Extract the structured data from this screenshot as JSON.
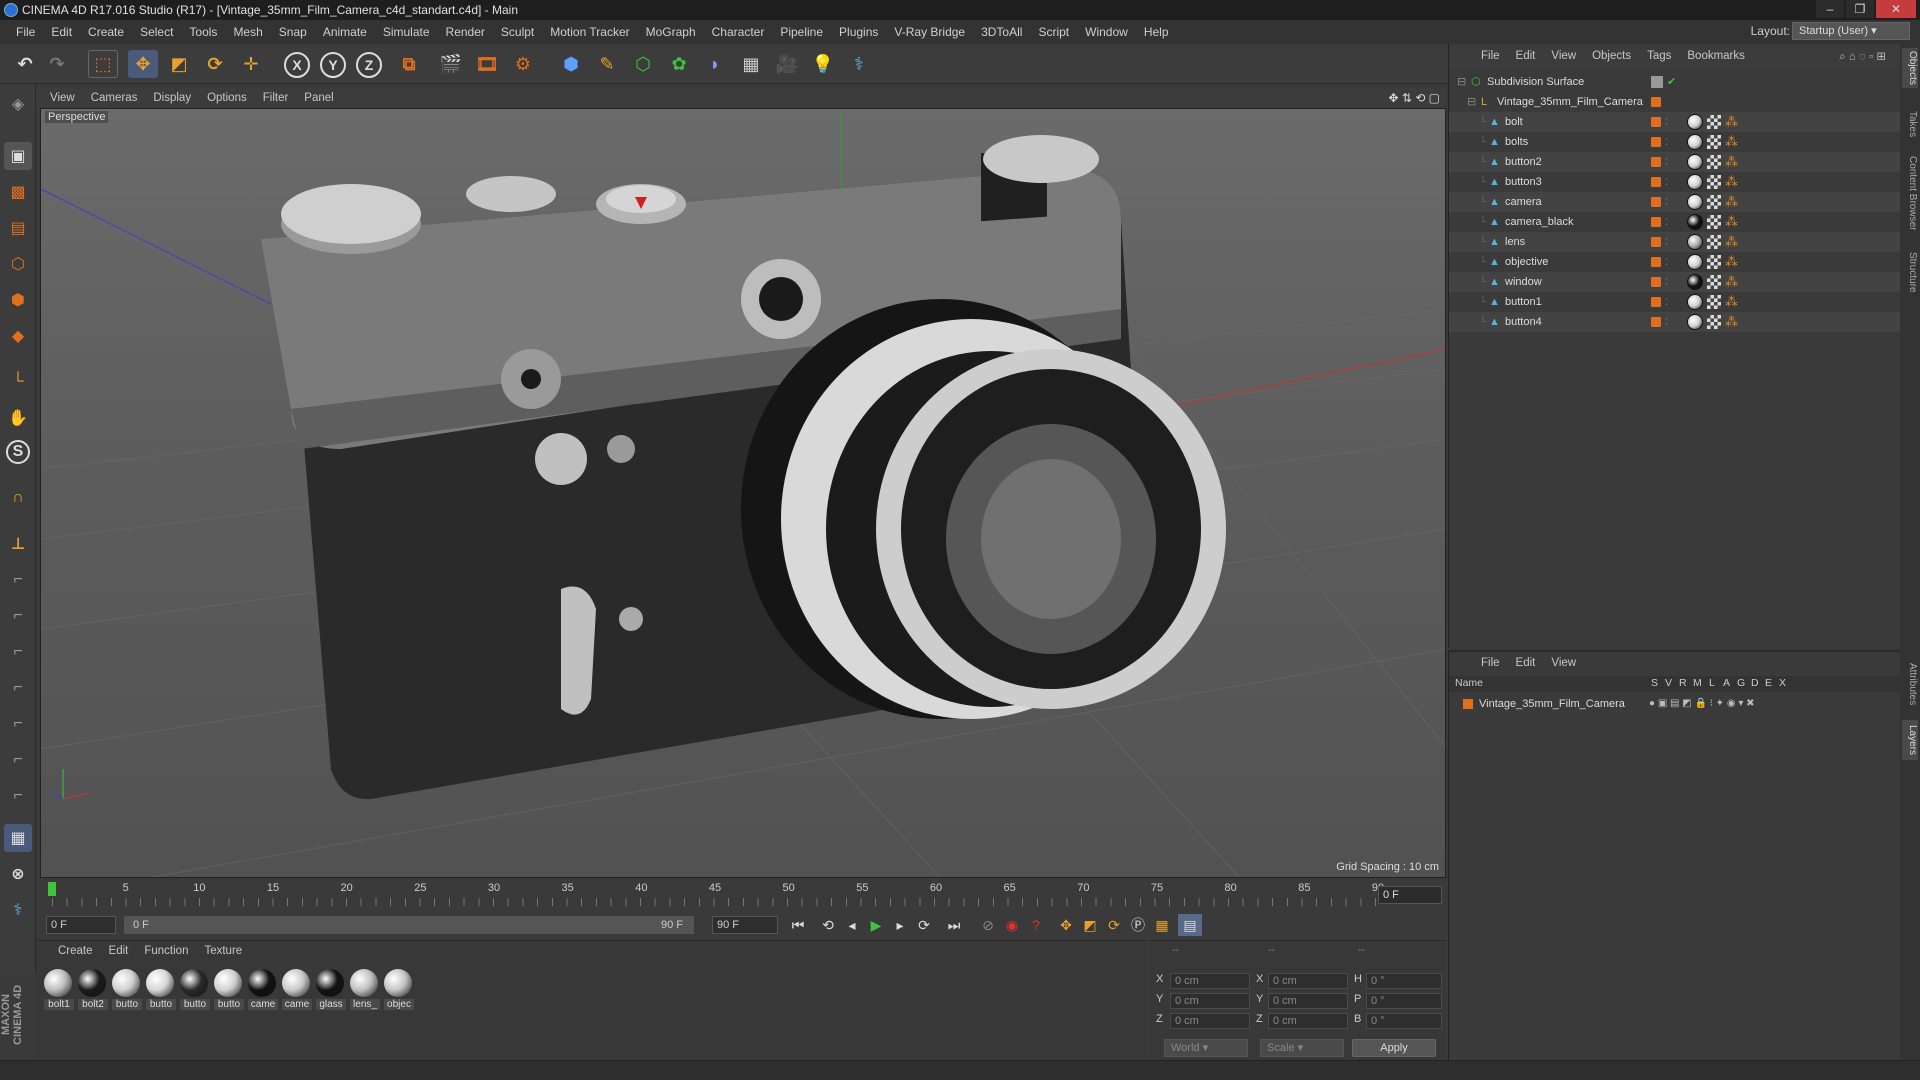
{
  "window": {
    "title": "CINEMA 4D R17.016 Studio (R17) - [Vintage_35mm_Film_Camera_c4d_standart.c4d] - Main"
  },
  "menu": [
    "File",
    "Edit",
    "Create",
    "Select",
    "Tools",
    "Mesh",
    "Snap",
    "Animate",
    "Simulate",
    "Render",
    "Sculpt",
    "Motion Tracker",
    "MoGraph",
    "Character",
    "Pipeline",
    "Plugins",
    "V-Ray Bridge",
    "3DToAll",
    "Script",
    "Window",
    "Help"
  ],
  "layout": {
    "label": "Layout:",
    "value": "Startup (User)"
  },
  "viewport": {
    "menu": [
      "View",
      "Cameras",
      "Display",
      "Options",
      "Filter",
      "Panel"
    ],
    "label": "Perspective",
    "grid_spacing": "Grid Spacing : 10 cm"
  },
  "timeline": {
    "ticks": [
      "0",
      "5",
      "10",
      "15",
      "20",
      "25",
      "30",
      "35",
      "40",
      "45",
      "50",
      "55",
      "60",
      "65",
      "70",
      "75",
      "80",
      "85",
      "90"
    ],
    "current_frame": "0 F",
    "start_field": "0 F",
    "range_start": "0 F",
    "range_end": "90 F",
    "end_field": "90 F"
  },
  "materials": {
    "menu": [
      "Create",
      "Edit",
      "Function",
      "Texture"
    ],
    "items": [
      {
        "label": "bolt1",
        "color": "#bdbdbd"
      },
      {
        "label": "bolt2",
        "color": "#1a1a1a"
      },
      {
        "label": "butto",
        "color": "#cfcfcf"
      },
      {
        "label": "butto",
        "color": "#d6d6d6"
      },
      {
        "label": "butto",
        "color": "#2a2a2a"
      },
      {
        "label": "butto",
        "color": "#d0d0d0"
      },
      {
        "label": "came",
        "color": "#111111"
      },
      {
        "label": "came",
        "color": "#c9c9c9"
      },
      {
        "label": "glass",
        "color": "#121212"
      },
      {
        "label": "lens_",
        "color": "#bfbfbf"
      },
      {
        "label": "objec",
        "color": "#c4c4c4"
      }
    ]
  },
  "coords": {
    "header": [
      "--",
      "--",
      "--"
    ],
    "rows": [
      {
        "a": "X",
        "av": "0 cm",
        "b": "X",
        "bv": "0 cm",
        "c": "H",
        "cv": "0 °"
      },
      {
        "a": "Y",
        "av": "0 cm",
        "b": "Y",
        "bv": "0 cm",
        "c": "P",
        "cv": "0 °"
      },
      {
        "a": "Z",
        "av": "0 cm",
        "b": "Z",
        "bv": "0 cm",
        "c": "B",
        "cv": "0 °"
      }
    ],
    "mode1": "World",
    "mode2": "Scale",
    "apply": "Apply"
  },
  "objects": {
    "menu": [
      "File",
      "Edit",
      "View",
      "Objects",
      "Tags",
      "Bookmarks"
    ],
    "root": "Subdivision Surface",
    "group": "Vintage_35mm_Film_Camera",
    "children": [
      {
        "name": "bolt",
        "mat": "#d0d0d0"
      },
      {
        "name": "bolts",
        "mat": "#d0d0d0"
      },
      {
        "name": "button2",
        "mat": "#d0d0d0"
      },
      {
        "name": "button3",
        "mat": "#d0d0d0"
      },
      {
        "name": "camera",
        "mat": "#d0d0d0"
      },
      {
        "name": "camera_black",
        "mat": "#111111"
      },
      {
        "name": "lens",
        "mat": "#aaaaaa"
      },
      {
        "name": "objective",
        "mat": "#d0d0d0"
      },
      {
        "name": "window",
        "mat": "#111111"
      },
      {
        "name": "button1",
        "mat": "#d0d0d0"
      },
      {
        "name": "button4",
        "mat": "#d0d0d0"
      }
    ]
  },
  "layers": {
    "menu": [
      "File",
      "Edit",
      "View"
    ],
    "columns": [
      "Name",
      "S",
      "V",
      "R",
      "M",
      "L",
      "A",
      "G",
      "D",
      "E",
      "X"
    ],
    "items": [
      "Vintage_35mm_Film_Camera"
    ]
  },
  "side_tabs": [
    "Objects",
    "Takes",
    "Content Browser",
    "Structure",
    "Attributes",
    "Layers"
  ],
  "brand": "MAXON CINEMA 4D",
  "accent": {
    "orange": "#e07020",
    "blue": "#3b82e8"
  }
}
